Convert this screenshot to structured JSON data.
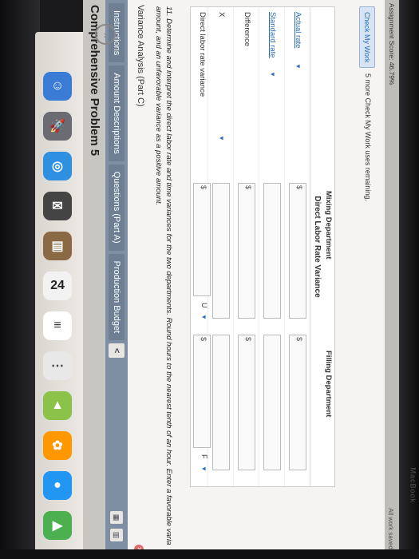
{
  "document": {
    "title": "Comprehensive Problem 5",
    "tabs": [
      "Instructions",
      "Amount Descriptions",
      "Questions (Part A)",
      "Production Budget"
    ],
    "nav_prev": "<"
  },
  "panel": {
    "section_title": "Variance Analysis (Part C)",
    "instructions": "11. Determine and interpret the direct labor rate and time variances for the two departments. Round hours to the nearest tenth of an hour. Enter a favorable varia amount, and an unfavorable variance as a positive amount.",
    "table_title": "Direct Labor Rate Variance",
    "columns": [
      "Mixing Department",
      "Filling Department"
    ],
    "rows": [
      {
        "label": "Actual rate",
        "dropdown": true
      },
      {
        "label": "Standard rate",
        "dropdown": true
      },
      {
        "label": "Difference",
        "dropdown": false
      },
      {
        "label": "X",
        "dropdown": true
      },
      {
        "label": "Direct labor rate variance",
        "dropdown": false
      }
    ],
    "currency_symbol": "$",
    "variance_marks": [
      "U",
      "F"
    ]
  },
  "footer": {
    "check_button": "Check My Work",
    "check_note": "5 more Check My Work uses remaining.",
    "assignment_score": "Assignment Score: 46.79%",
    "all_work": "All work saved."
  },
  "device": {
    "brand": "MacBook",
    "calendar_day": "24"
  },
  "colors": {
    "accent": "#2a6db5",
    "tabbar": "#7f8fa3"
  }
}
